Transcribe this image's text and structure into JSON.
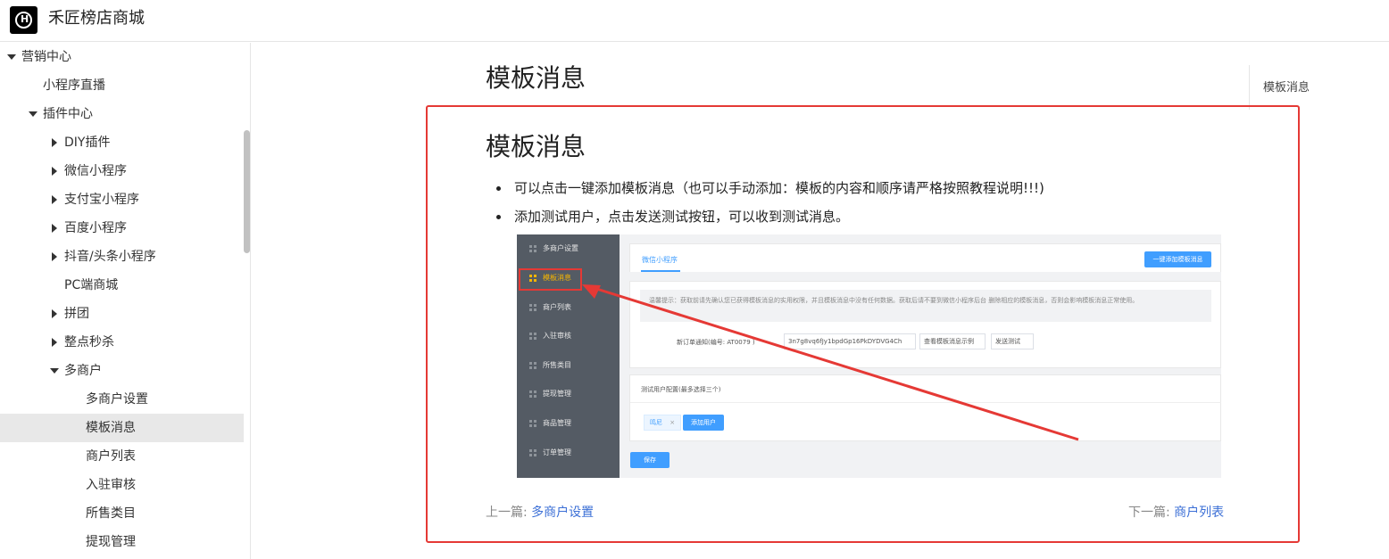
{
  "header": {
    "logo_text": "H",
    "site_title": "禾匠榜店商城"
  },
  "sidebar": {
    "items": [
      {
        "label": "营销中心"
      },
      {
        "label": "小程序直播"
      },
      {
        "label": "插件中心"
      },
      {
        "label": "DIY插件"
      },
      {
        "label": "微信小程序"
      },
      {
        "label": "支付宝小程序"
      },
      {
        "label": "百度小程序"
      },
      {
        "label": "抖音/头条小程序"
      },
      {
        "label": "PC端商城"
      },
      {
        "label": "拼团"
      },
      {
        "label": "整点秒杀"
      },
      {
        "label": "多商户"
      },
      {
        "label": "多商户设置"
      },
      {
        "label": "模板消息"
      },
      {
        "label": "商户列表"
      },
      {
        "label": "入驻审核"
      },
      {
        "label": "所售类目"
      },
      {
        "label": "提现管理"
      }
    ]
  },
  "main": {
    "page_title": "模板消息",
    "section_title": "模板消息",
    "bullets": [
      "可以点击一键添加模板消息（也可以手动添加：模板的内容和顺序请严格按照教程说明!!!)",
      "添加测试用户，点击发送测试按钮，可以收到测试消息。"
    ],
    "prev_label": "上一篇:",
    "prev_link": "多商户设置",
    "next_label": "下一篇:",
    "next_link": "商户列表"
  },
  "toc": {
    "items": [
      "模板消息"
    ]
  },
  "screenshot": {
    "menu": [
      "多商户设置",
      "模板消息",
      "商户列表",
      "入驻审核",
      "所售类目",
      "提现管理",
      "商品管理",
      "订单管理"
    ],
    "tab": "微信小程序",
    "one_click_button": "一键添加模板消息",
    "tip": "温馨提示：获取前请先确认您已获得模板消息的实用权限，并且模板消息中没有任何数据。获取后请不要到微信小程序后台 删除相应的模板消息，否则会影响模板消息正常使用。",
    "template_row_label": "新订单通知(编号: AT0079 )",
    "template_id": "3n7g8vq6fJy1bpdGp16PkDYDVG4Ch",
    "view_example_button": "查看模板消息示例",
    "send_test_button": "发送测试",
    "test_user_label": "测试用户配置(最多选择三个)",
    "test_user_tag": "鸣尼",
    "tag_close": "×",
    "add_user_button": "添加用户",
    "save_button": "保存"
  },
  "colors": {
    "highlight_red": "#e53935",
    "accent_blue": "#409eff",
    "link_blue": "#3b6fd6"
  }
}
